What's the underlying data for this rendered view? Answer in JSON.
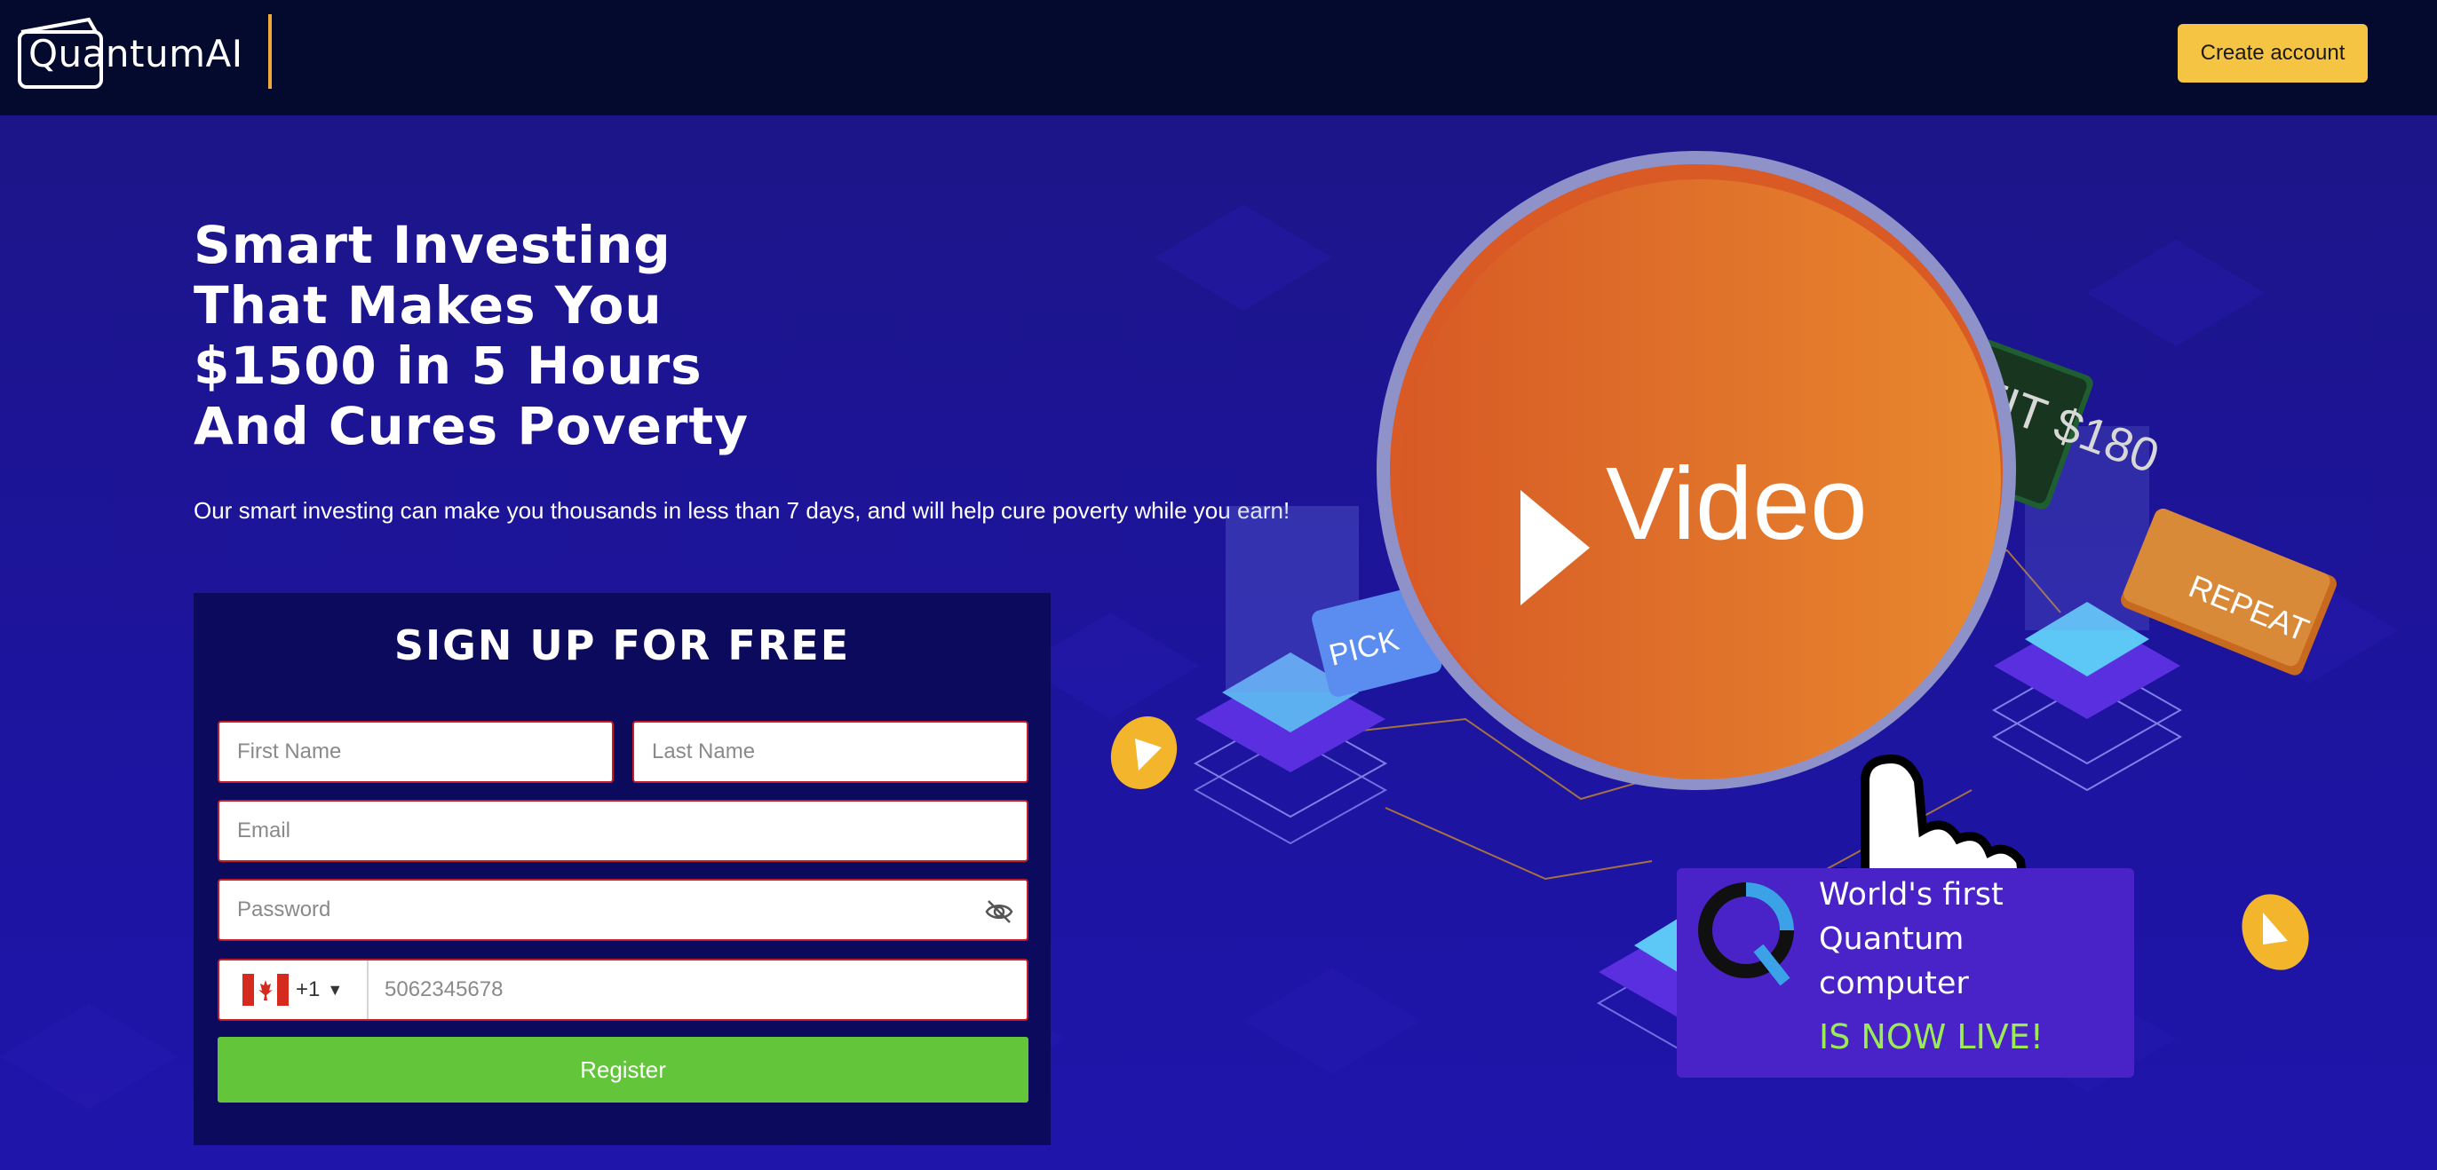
{
  "header": {
    "logo_text": "QuantumAI",
    "create_account_label": "Create account"
  },
  "hero": {
    "headline_lines": [
      "Smart Investing",
      "That Makes You",
      "$1500 in 5 Hours",
      "And Cures Poverty"
    ],
    "subheadline": "Our smart investing can make you thousands in less than 7 days, and will help cure poverty while you earn!"
  },
  "signup": {
    "title": "SIGN UP FOR FREE",
    "first_name_placeholder": "First Name",
    "last_name_placeholder": "Last Name",
    "email_placeholder": "Email",
    "password_placeholder": "Password",
    "phone_dial_code": "+1",
    "phone_placeholder": "5062345678",
    "register_label": "Register"
  },
  "illustration": {
    "video_label": "Video",
    "profit_tag": "PROFIT $180",
    "repeat_tag": "REPEAT",
    "pick_tag": "PICK",
    "quantum_card": {
      "line1": "World's first",
      "line2": "Quantum",
      "line3": "computer",
      "live": "IS NOW LIVE!"
    }
  },
  "colors": {
    "topbar": "#040a2e",
    "hero_bg": "#1d14a0",
    "accent_yellow": "#f5c443",
    "register_green": "#62c53a",
    "video_orange": "#e0702a",
    "live_green": "#9bea56"
  }
}
